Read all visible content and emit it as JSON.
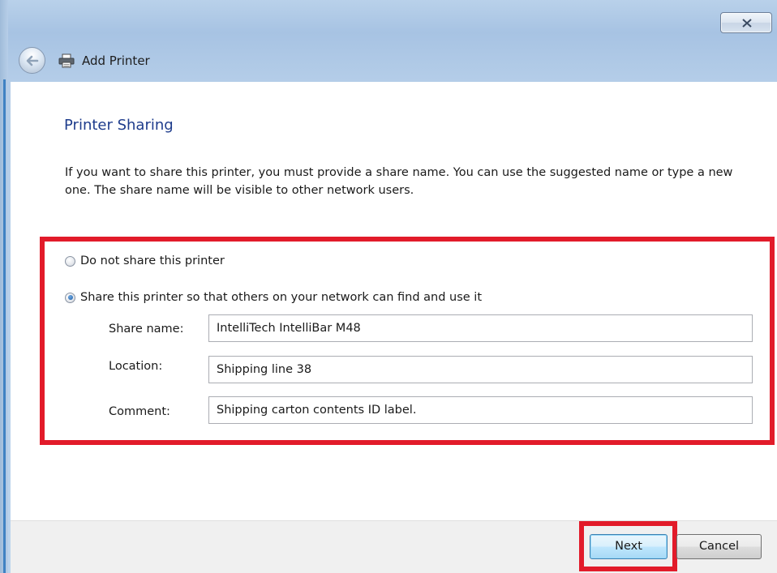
{
  "window": {
    "title": "Add Printer",
    "close_symbol": "close-icon"
  },
  "page": {
    "title": "Printer Sharing",
    "description": "If you want to share this printer, you must provide a share name. You can use the suggested name or type a new one. The share name will be visible to other network users."
  },
  "sharing": {
    "options": [
      {
        "label": "Do not share this printer",
        "selected": false
      },
      {
        "label": "Share this printer so that others on your network can find and use it",
        "selected": true
      }
    ],
    "fields": {
      "share_name": {
        "label": "Share name:",
        "value": "IntelliTech IntelliBar M48"
      },
      "location": {
        "label": "Location:",
        "value": "Shipping line 38"
      },
      "comment": {
        "label": "Comment:",
        "value": "Shipping carton contents ID label."
      }
    }
  },
  "footer": {
    "next_label": "Next",
    "cancel_label": "Cancel"
  },
  "colors": {
    "highlight": "#e21b2a",
    "title_blue": "#1e3c8c",
    "frame": "#b4cde8"
  }
}
